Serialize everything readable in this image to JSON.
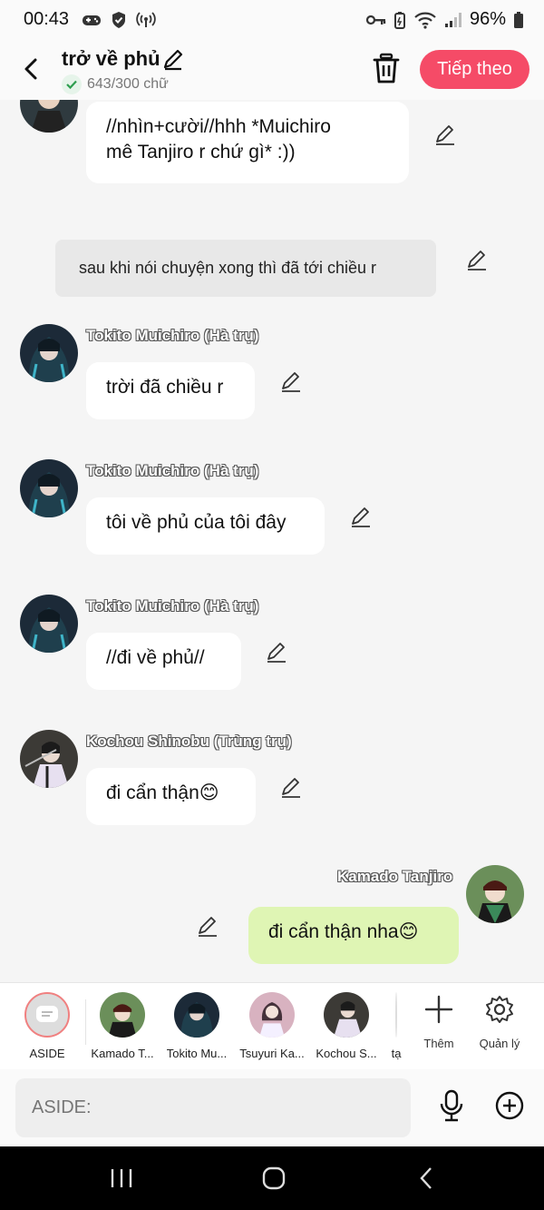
{
  "status_bar": {
    "time": "00:43",
    "battery": "96%"
  },
  "header": {
    "title": "trở về phủ",
    "word_count": "643/300 chữ",
    "next_button": "Tiếp theo"
  },
  "messages": [
    {
      "speaker": "",
      "text_lines": [
        "//nhìn+cười//hhh *Muichiro",
        "mê Tanjiro r chứ gì* :))"
      ],
      "side": "left"
    },
    {
      "narration": "sau khi nói chuyện xong thì đã tới chiều r"
    },
    {
      "speaker": "Tokito Muichiro (Hà trụ)",
      "text": "trời đã chiều r",
      "side": "left"
    },
    {
      "speaker": "Tokito Muichiro (Hà trụ)",
      "text": "tôi về phủ của tôi đây",
      "side": "left"
    },
    {
      "speaker": "Tokito Muichiro (Hà trụ)",
      "text": "//đi về phủ//",
      "side": "left"
    },
    {
      "speaker": "Kochou Shinobu (Trùng trụ)",
      "text": "đi cẩn thận😊",
      "side": "left"
    },
    {
      "speaker": "Kamado Tanjiro",
      "text": "đi cẩn thận nha😊",
      "side": "right"
    }
  ],
  "characters": [
    {
      "name": "ASIDE"
    },
    {
      "name": "Kamado T..."
    },
    {
      "name": "Tokito Mu..."
    },
    {
      "name": "Tsuyuri Ka..."
    },
    {
      "name": "Kochou S..."
    },
    {
      "name": "tạ"
    }
  ],
  "tools": {
    "add_label": "Thêm",
    "manage_label": "Quản lý"
  },
  "input": {
    "placeholder": "ASIDE:"
  },
  "colors": {
    "accent": "#f54b67",
    "my_bubble": "#dff5b4",
    "background": "#f5f5f5"
  }
}
